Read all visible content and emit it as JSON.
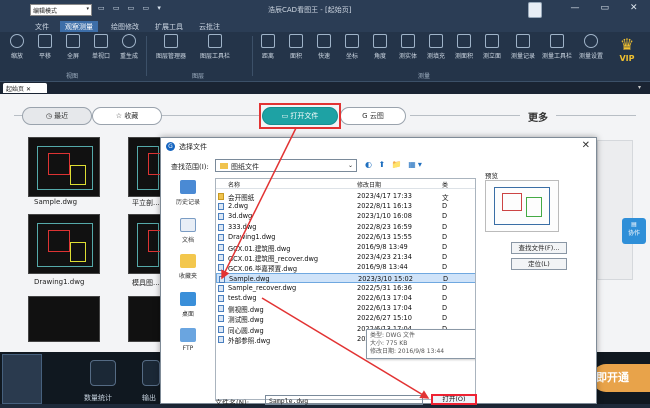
{
  "titlebar": {
    "mode": "编辑模式",
    "qat": "▭ ▭ ▭ ▭ ▾",
    "title": "浩辰CAD看图王 - [起始页]",
    "controls": [
      "—",
      "▭",
      "✕"
    ]
  },
  "menu": [
    "文件",
    "观察测量",
    "绘图修改",
    "扩展工具",
    "云批注"
  ],
  "ribbon": {
    "view_tools": [
      "缩放",
      "平移",
      "全屏",
      "单视口",
      "重生成"
    ],
    "layer_tools": [
      "图层管理器",
      "图层工具栏"
    ],
    "measure_tools": [
      "距离",
      "面积",
      "快速",
      "坐标",
      "角度",
      "测实体",
      "测填充",
      "测面积",
      "测立面",
      "测量记录",
      "测量工具栏",
      "测量设置"
    ],
    "groups": [
      "视图",
      "图层",
      "测量"
    ],
    "vip": "VIP"
  },
  "tabs": {
    "home": "起始页",
    "close": "✕",
    "dropdown": "▾"
  },
  "home": {
    "recent": "最近",
    "favorites": "收藏",
    "open": "打开文件",
    "cloud": "云图",
    "more": "更多",
    "thumbs": [
      {
        "name": "Sample.dwg"
      },
      {
        "name": "平立剖..."
      },
      {
        "name": "Drawing1.dwg"
      },
      {
        "name": "模具图..."
      }
    ],
    "float_btn": "协作"
  },
  "bottom": {
    "stats": "数量统计",
    "output": "输出",
    "openvip": "即开通"
  },
  "dialog": {
    "title": "选择文件",
    "lookin_label": "查找范围(I):",
    "lookin_value": "图纸文件",
    "columns": [
      "名称",
      "修改日期",
      "类"
    ],
    "places": [
      "历史记录",
      "文档",
      "收藏夹",
      "桌面",
      "FTP"
    ],
    "files": [
      {
        "name": "会开图纸",
        "date": "2023/4/17 17:33",
        "type": "文",
        "dir": true
      },
      {
        "name": "2.dwg",
        "date": "2022/8/11 16:13",
        "type": "D"
      },
      {
        "name": "3d.dwg",
        "date": "2023/1/10 16:08",
        "type": "D"
      },
      {
        "name": "333.dwg",
        "date": "2022/8/23 16:59",
        "type": "D"
      },
      {
        "name": "Drawing1.dwg",
        "date": "2022/6/13 15:55",
        "type": "D"
      },
      {
        "name": "GCX.01.建筑图.dwg",
        "date": "2016/9/8 13:49",
        "type": "D"
      },
      {
        "name": "GCX.01.建筑图_recover.dwg",
        "date": "2023/4/23 21:34",
        "type": "D"
      },
      {
        "name": "GCX.06.毕嘉预置.dwg",
        "date": "2016/9/8 13:44",
        "type": "D"
      },
      {
        "name": "Sample.dwg",
        "date": "2023/3/10 15:02",
        "type": "D",
        "selected": true
      },
      {
        "name": "Sample_recover.dwg",
        "date": "2022/5/31 16:36",
        "type": "D"
      },
      {
        "name": "test.dwg",
        "date": "2022/6/13 17:04",
        "type": "D"
      },
      {
        "name": "侧视图.dwg",
        "date": "2022/6/13 17:04",
        "type": "D"
      },
      {
        "name": "测试图.dwg",
        "date": "2022/6/27 15:10",
        "type": "D"
      },
      {
        "name": "同心圆.dwg",
        "date": "2022/6/13 17:04",
        "type": "D"
      },
      {
        "name": "外部参照.dwg",
        "date": "2022/2/11 15:07",
        "type": "D"
      }
    ],
    "tooltip": [
      "类型: DWG 文件",
      "大小: 775 KB",
      "修改日期: 2016/9/8 13:44"
    ],
    "preview_label": "预览",
    "find_btn": "查找文件(F)...",
    "locate_btn": "定位(L)",
    "filename_label": "文件名(N):",
    "filename_value": "Sample.dwg",
    "open_btn": "打开(O)",
    "nav_icons": "◐ ⬆ 📁 ▦▾"
  },
  "colors": {
    "accent": "#1ea2a4",
    "highlight": "#e23333",
    "vip": "#e8a34a"
  }
}
